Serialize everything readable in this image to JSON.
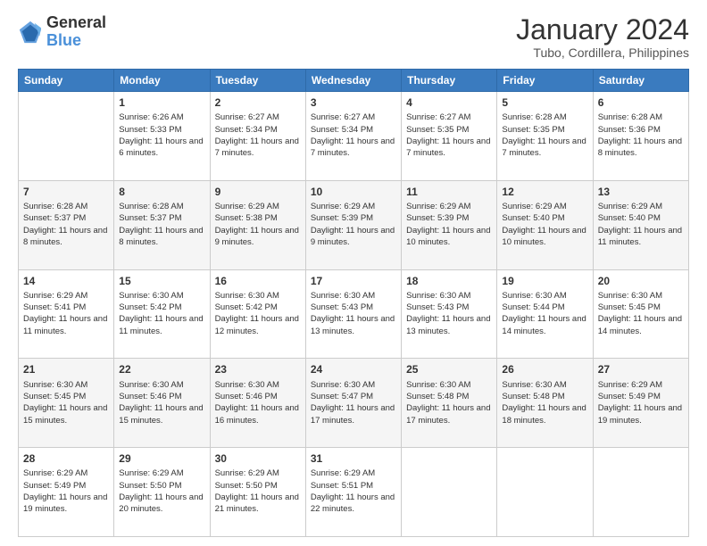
{
  "header": {
    "logo_line1": "General",
    "logo_line2": "Blue",
    "title": "January 2024",
    "subtitle": "Tubo, Cordillera, Philippines"
  },
  "days_of_week": [
    "Sunday",
    "Monday",
    "Tuesday",
    "Wednesday",
    "Thursday",
    "Friday",
    "Saturday"
  ],
  "weeks": [
    [
      {
        "day": "",
        "sunrise": "",
        "sunset": "",
        "daylight": ""
      },
      {
        "day": "1",
        "sunrise": "Sunrise: 6:26 AM",
        "sunset": "Sunset: 5:33 PM",
        "daylight": "Daylight: 11 hours and 6 minutes."
      },
      {
        "day": "2",
        "sunrise": "Sunrise: 6:27 AM",
        "sunset": "Sunset: 5:34 PM",
        "daylight": "Daylight: 11 hours and 7 minutes."
      },
      {
        "day": "3",
        "sunrise": "Sunrise: 6:27 AM",
        "sunset": "Sunset: 5:34 PM",
        "daylight": "Daylight: 11 hours and 7 minutes."
      },
      {
        "day": "4",
        "sunrise": "Sunrise: 6:27 AM",
        "sunset": "Sunset: 5:35 PM",
        "daylight": "Daylight: 11 hours and 7 minutes."
      },
      {
        "day": "5",
        "sunrise": "Sunrise: 6:28 AM",
        "sunset": "Sunset: 5:35 PM",
        "daylight": "Daylight: 11 hours and 7 minutes."
      },
      {
        "day": "6",
        "sunrise": "Sunrise: 6:28 AM",
        "sunset": "Sunset: 5:36 PM",
        "daylight": "Daylight: 11 hours and 8 minutes."
      }
    ],
    [
      {
        "day": "7",
        "sunrise": "Sunrise: 6:28 AM",
        "sunset": "Sunset: 5:37 PM",
        "daylight": "Daylight: 11 hours and 8 minutes."
      },
      {
        "day": "8",
        "sunrise": "Sunrise: 6:28 AM",
        "sunset": "Sunset: 5:37 PM",
        "daylight": "Daylight: 11 hours and 8 minutes."
      },
      {
        "day": "9",
        "sunrise": "Sunrise: 6:29 AM",
        "sunset": "Sunset: 5:38 PM",
        "daylight": "Daylight: 11 hours and 9 minutes."
      },
      {
        "day": "10",
        "sunrise": "Sunrise: 6:29 AM",
        "sunset": "Sunset: 5:39 PM",
        "daylight": "Daylight: 11 hours and 9 minutes."
      },
      {
        "day": "11",
        "sunrise": "Sunrise: 6:29 AM",
        "sunset": "Sunset: 5:39 PM",
        "daylight": "Daylight: 11 hours and 10 minutes."
      },
      {
        "day": "12",
        "sunrise": "Sunrise: 6:29 AM",
        "sunset": "Sunset: 5:40 PM",
        "daylight": "Daylight: 11 hours and 10 minutes."
      },
      {
        "day": "13",
        "sunrise": "Sunrise: 6:29 AM",
        "sunset": "Sunset: 5:40 PM",
        "daylight": "Daylight: 11 hours and 11 minutes."
      }
    ],
    [
      {
        "day": "14",
        "sunrise": "Sunrise: 6:29 AM",
        "sunset": "Sunset: 5:41 PM",
        "daylight": "Daylight: 11 hours and 11 minutes."
      },
      {
        "day": "15",
        "sunrise": "Sunrise: 6:30 AM",
        "sunset": "Sunset: 5:42 PM",
        "daylight": "Daylight: 11 hours and 11 minutes."
      },
      {
        "day": "16",
        "sunrise": "Sunrise: 6:30 AM",
        "sunset": "Sunset: 5:42 PM",
        "daylight": "Daylight: 11 hours and 12 minutes."
      },
      {
        "day": "17",
        "sunrise": "Sunrise: 6:30 AM",
        "sunset": "Sunset: 5:43 PM",
        "daylight": "Daylight: 11 hours and 13 minutes."
      },
      {
        "day": "18",
        "sunrise": "Sunrise: 6:30 AM",
        "sunset": "Sunset: 5:43 PM",
        "daylight": "Daylight: 11 hours and 13 minutes."
      },
      {
        "day": "19",
        "sunrise": "Sunrise: 6:30 AM",
        "sunset": "Sunset: 5:44 PM",
        "daylight": "Daylight: 11 hours and 14 minutes."
      },
      {
        "day": "20",
        "sunrise": "Sunrise: 6:30 AM",
        "sunset": "Sunset: 5:45 PM",
        "daylight": "Daylight: 11 hours and 14 minutes."
      }
    ],
    [
      {
        "day": "21",
        "sunrise": "Sunrise: 6:30 AM",
        "sunset": "Sunset: 5:45 PM",
        "daylight": "Daylight: 11 hours and 15 minutes."
      },
      {
        "day": "22",
        "sunrise": "Sunrise: 6:30 AM",
        "sunset": "Sunset: 5:46 PM",
        "daylight": "Daylight: 11 hours and 15 minutes."
      },
      {
        "day": "23",
        "sunrise": "Sunrise: 6:30 AM",
        "sunset": "Sunset: 5:46 PM",
        "daylight": "Daylight: 11 hours and 16 minutes."
      },
      {
        "day": "24",
        "sunrise": "Sunrise: 6:30 AM",
        "sunset": "Sunset: 5:47 PM",
        "daylight": "Daylight: 11 hours and 17 minutes."
      },
      {
        "day": "25",
        "sunrise": "Sunrise: 6:30 AM",
        "sunset": "Sunset: 5:48 PM",
        "daylight": "Daylight: 11 hours and 17 minutes."
      },
      {
        "day": "26",
        "sunrise": "Sunrise: 6:30 AM",
        "sunset": "Sunset: 5:48 PM",
        "daylight": "Daylight: 11 hours and 18 minutes."
      },
      {
        "day": "27",
        "sunrise": "Sunrise: 6:29 AM",
        "sunset": "Sunset: 5:49 PM",
        "daylight": "Daylight: 11 hours and 19 minutes."
      }
    ],
    [
      {
        "day": "28",
        "sunrise": "Sunrise: 6:29 AM",
        "sunset": "Sunset: 5:49 PM",
        "daylight": "Daylight: 11 hours and 19 minutes."
      },
      {
        "day": "29",
        "sunrise": "Sunrise: 6:29 AM",
        "sunset": "Sunset: 5:50 PM",
        "daylight": "Daylight: 11 hours and 20 minutes."
      },
      {
        "day": "30",
        "sunrise": "Sunrise: 6:29 AM",
        "sunset": "Sunset: 5:50 PM",
        "daylight": "Daylight: 11 hours and 21 minutes."
      },
      {
        "day": "31",
        "sunrise": "Sunrise: 6:29 AM",
        "sunset": "Sunset: 5:51 PM",
        "daylight": "Daylight: 11 hours and 22 minutes."
      },
      {
        "day": "",
        "sunrise": "",
        "sunset": "",
        "daylight": ""
      },
      {
        "day": "",
        "sunrise": "",
        "sunset": "",
        "daylight": ""
      },
      {
        "day": "",
        "sunrise": "",
        "sunset": "",
        "daylight": ""
      }
    ]
  ]
}
